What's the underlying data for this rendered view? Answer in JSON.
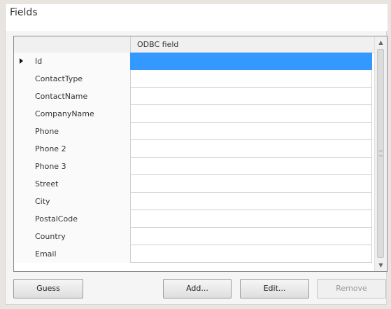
{
  "section": {
    "title": "Fields"
  },
  "grid": {
    "column_header": "ODBC field",
    "rows": [
      {
        "label": "Id",
        "selected": true
      },
      {
        "label": "ContactType"
      },
      {
        "label": "ContactName"
      },
      {
        "label": "CompanyName"
      },
      {
        "label": "Phone"
      },
      {
        "label": "Phone 2"
      },
      {
        "label": "Phone 3"
      },
      {
        "label": "Street"
      },
      {
        "label": "City"
      },
      {
        "label": "PostalCode"
      },
      {
        "label": "Country"
      },
      {
        "label": "Email"
      }
    ]
  },
  "buttons": {
    "guess": "Guess",
    "add": "Add...",
    "edit": "Edit...",
    "remove": "Remove"
  },
  "colors": {
    "selection": "#3399ff",
    "panel_bg": "#f5f5f5"
  }
}
